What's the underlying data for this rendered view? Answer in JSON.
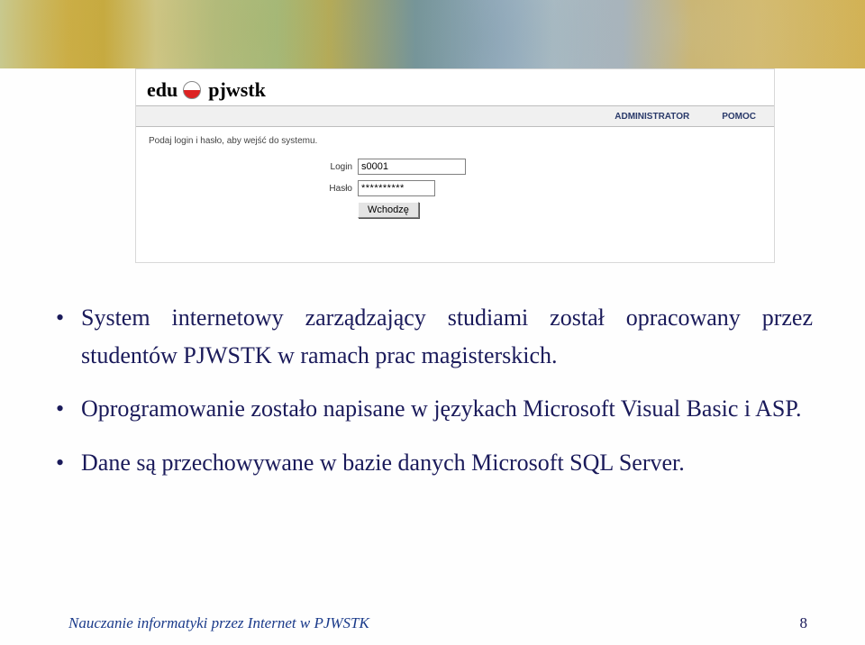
{
  "logo": {
    "edu": "edu",
    "pjwstk": "pjwstk"
  },
  "nav": {
    "admin": "ADMINISTRATOR",
    "help": "POMOC"
  },
  "login": {
    "prompt": "Podaj login i hasło, aby wejść do systemu.",
    "login_label": "Login",
    "login_value": "s0001",
    "pass_label": "Hasło",
    "pass_value": "**********",
    "submit": "Wchodzę"
  },
  "bullets": {
    "b1": "System internetowy zarządzający studiami został opracowany przez studentów PJWSTK w ramach prac magisterskich.",
    "b2": "Oprogramowanie zostało napisane w językach Microsoft Visual Basic i ASP.",
    "b3": "Dane są przechowywane w bazie danych Microsoft SQL Server."
  },
  "footer": {
    "text": "Nauczanie informatyki przez Internet w PJWSTK",
    "page": "8"
  },
  "bullet_char": "•"
}
